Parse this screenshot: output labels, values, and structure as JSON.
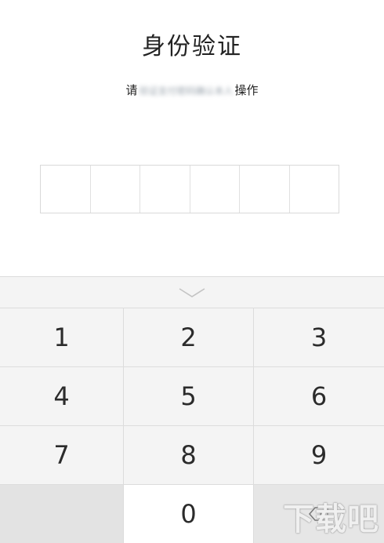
{
  "header": {
    "title": "身份验证",
    "subtitle_prefix": "请",
    "subtitle_redacted": "验证支付密码确认本人",
    "subtitle_suffix": "操作"
  },
  "pin": {
    "length": 6
  },
  "keyboard": {
    "collapse_icon": "chevron-down-icon",
    "keys": {
      "k1": "1",
      "k2": "2",
      "k3": "3",
      "k4": "4",
      "k5": "5",
      "k6": "6",
      "k7": "7",
      "k8": "8",
      "k9": "9",
      "k0": "0"
    },
    "delete_icon": "backspace-icon"
  },
  "watermark": {
    "text": "下载吧"
  },
  "colors": {
    "keyboard_bg": "#f4f4f4",
    "divider": "#dcdcdc",
    "text": "#222222"
  }
}
